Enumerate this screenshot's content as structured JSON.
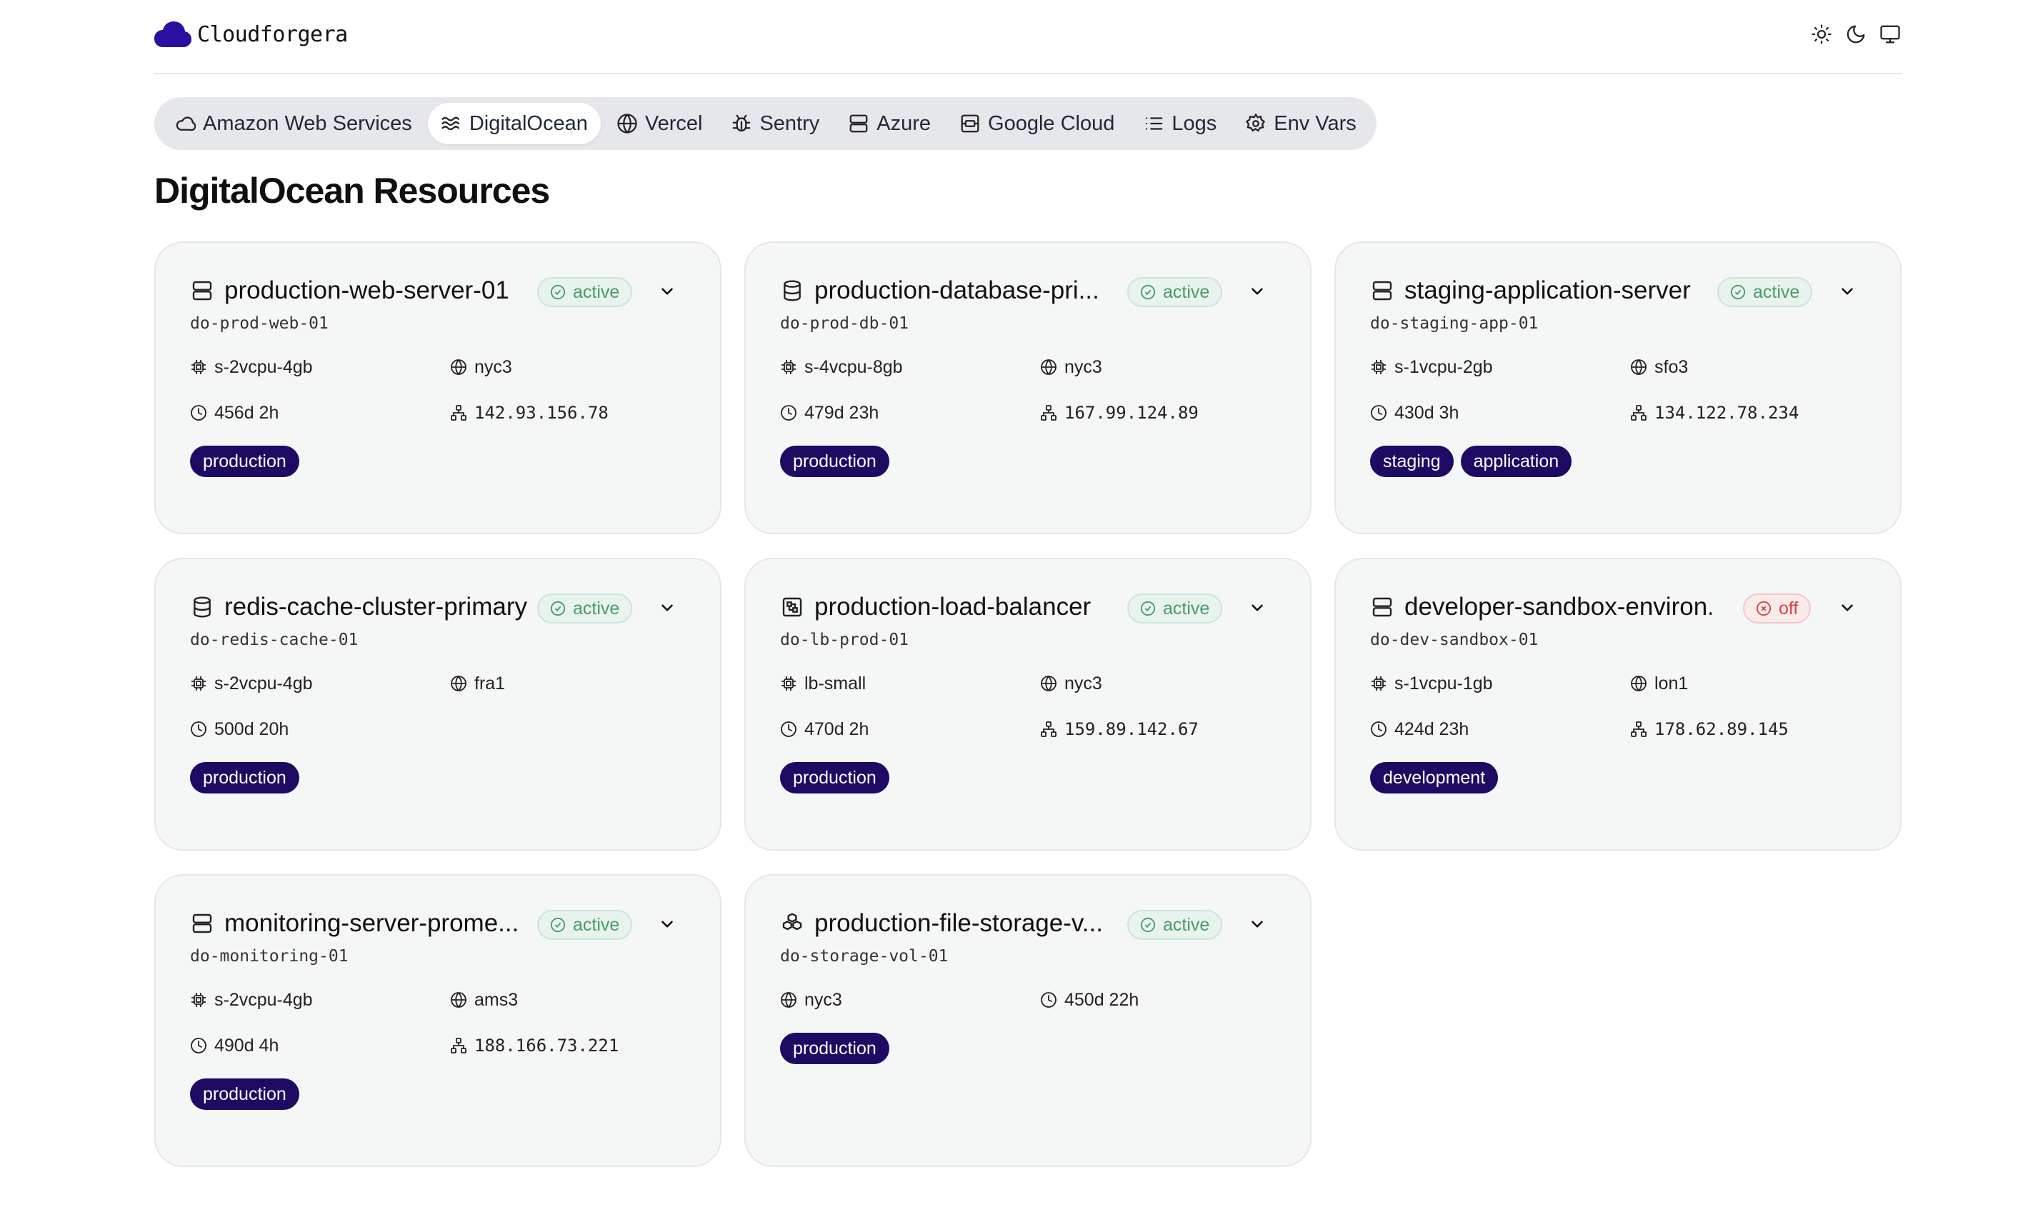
{
  "app": {
    "name": "Cloudforgera"
  },
  "theme_icons": [
    "sun-icon",
    "moon-icon",
    "monitor-icon"
  ],
  "tabs": [
    {
      "label": "Amazon Web Services",
      "icon": "cloud-icon",
      "active": false
    },
    {
      "label": "DigitalOcean",
      "icon": "waves-icon",
      "active": true
    },
    {
      "label": "Vercel",
      "icon": "globe-icon",
      "active": false
    },
    {
      "label": "Sentry",
      "icon": "bug-icon",
      "active": false
    },
    {
      "label": "Azure",
      "icon": "server-icon",
      "active": false
    },
    {
      "label": "Google Cloud",
      "icon": "hdd-icon",
      "active": false
    },
    {
      "label": "Logs",
      "icon": "list-icon",
      "active": false
    },
    {
      "label": "Env Vars",
      "icon": "gear-icon",
      "active": false
    }
  ],
  "page_title": "DigitalOcean Resources",
  "colors": {
    "tag_bg": "#1e0a63",
    "active_green": "#4a9a6a",
    "off_red": "#d24545"
  },
  "cards": [
    {
      "title": "production-web-server-01",
      "icon": "server-icon",
      "status": "active",
      "id": "do-prod-web-01",
      "size": "s-2vcpu-4gb",
      "region": "nyc3",
      "uptime": "456d 2h",
      "ip": "142.93.156.78",
      "tags": [
        "production"
      ]
    },
    {
      "title": "production-database-pri...",
      "icon": "database-icon",
      "status": "active",
      "id": "do-prod-db-01",
      "size": "s-4vcpu-8gb",
      "region": "nyc3",
      "uptime": "479d 23h",
      "ip": "167.99.124.89",
      "tags": [
        "production"
      ]
    },
    {
      "title": "staging-application-server",
      "icon": "server-icon",
      "status": "active",
      "id": "do-staging-app-01",
      "size": "s-1vcpu-2gb",
      "region": "sfo3",
      "uptime": "430d 3h",
      "ip": "134.122.78.234",
      "tags": [
        "staging",
        "application"
      ]
    },
    {
      "title": "redis-cache-cluster-primary",
      "icon": "database-icon",
      "status": "active",
      "id": "do-redis-cache-01",
      "size": "s-2vcpu-4gb",
      "region": "fra1",
      "uptime": "500d 20h",
      "ip": "",
      "tags": [
        "production"
      ]
    },
    {
      "title": "production-load-balancer",
      "icon": "load-balancer-icon",
      "status": "active",
      "id": "do-lb-prod-01",
      "size": "lb-small",
      "region": "nyc3",
      "uptime": "470d 2h",
      "ip": "159.89.142.67",
      "tags": [
        "production"
      ]
    },
    {
      "title": "developer-sandbox-environ...",
      "icon": "server-icon",
      "status": "off",
      "id": "do-dev-sandbox-01",
      "size": "s-1vcpu-1gb",
      "region": "lon1",
      "uptime": "424d 23h",
      "ip": "178.62.89.145",
      "tags": [
        "development"
      ]
    },
    {
      "title": "monitoring-server-prome...",
      "icon": "server-icon",
      "status": "active",
      "id": "do-monitoring-01",
      "size": "s-2vcpu-4gb",
      "region": "ams3",
      "uptime": "490d 4h",
      "ip": "188.166.73.221",
      "tags": [
        "production"
      ]
    },
    {
      "title": "production-file-storage-v...",
      "icon": "boxes-icon",
      "status": "active",
      "id": "do-storage-vol-01",
      "size": "",
      "region": "nyc3",
      "uptime": "450d 22h",
      "ip": "",
      "tags": [
        "production"
      ]
    }
  ]
}
